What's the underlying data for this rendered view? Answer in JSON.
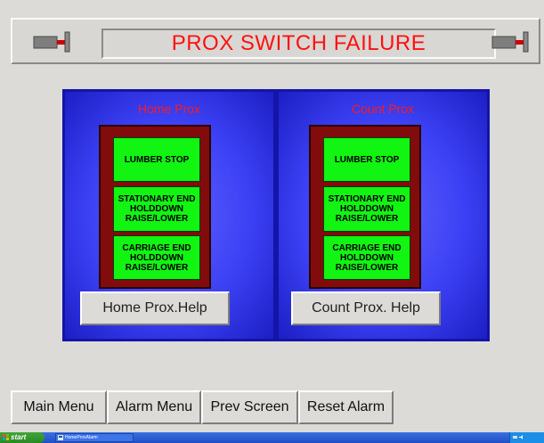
{
  "header": {
    "title": "PROX SWITCH FAILURE",
    "left_icon": "prox-switch-icon",
    "right_icon": "prox-switch-icon"
  },
  "panels": {
    "home": {
      "title": "Home Prox",
      "switches": [
        "LUMBER STOP",
        "STATIONARY END\nHOLDDOWN\nRAISE/LOWER",
        "CARRIAGE END\nHOLDDOWN\nRAISE/LOWER"
      ],
      "help_label": "Home Prox.Help"
    },
    "count": {
      "title": "Count Prox",
      "switches": [
        "LUMBER STOP",
        "STATIONARY END\nHOLDDOWN\nRAISE/LOWER",
        "CARRIAGE END\nHOLDDOWN\nRAISE/LOWER"
      ],
      "help_label": "Count Prox. Help"
    }
  },
  "nav": {
    "main_menu": "Main Menu",
    "alarm_menu": "Alarm Menu",
    "prev_screen": "Prev Screen",
    "reset_alarm": "Reset Alarm"
  },
  "taskbar": {
    "start_label": "start",
    "task_label": "HomeProxAlarm"
  },
  "colors": {
    "title_red": "#ff1010",
    "panel_blue": "#3b40f4",
    "frame_maroon": "#820b0b",
    "switch_green": "#12f412"
  }
}
